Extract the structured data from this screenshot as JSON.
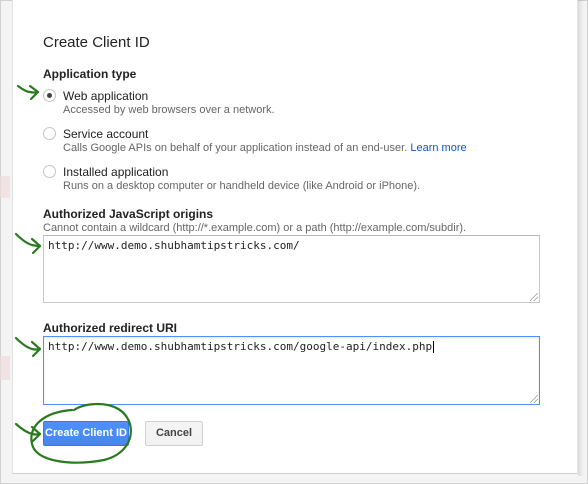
{
  "dialog": {
    "title": "Create Client ID",
    "application_type": {
      "heading": "Application type",
      "options": [
        {
          "label": "Web application",
          "description": "Accessed by web browsers over a network.",
          "checked": true
        },
        {
          "label": "Service account",
          "description": "Calls Google APIs on behalf of your application instead of an end-user.",
          "link": "Learn more",
          "checked": false
        },
        {
          "label": "Installed application",
          "description": "Runs on a desktop computer or handheld device (like Android or iPhone).",
          "checked": false
        }
      ]
    },
    "js_origins": {
      "heading": "Authorized JavaScript origins",
      "hint": "Cannot contain a wildcard (http://*.example.com) or a path (http://example.com/subdir).",
      "value": "http://www.demo.shubhamtipstricks.com/"
    },
    "redirect_uri": {
      "heading": "Authorized redirect URI",
      "value": "http://www.demo.shubhamtipstricks.com/google-api/index.php"
    },
    "buttons": {
      "create": "Create Client ID",
      "cancel": "Cancel"
    }
  },
  "annotation_color": "#2a7a1f",
  "primary_color": "#4d90fe"
}
